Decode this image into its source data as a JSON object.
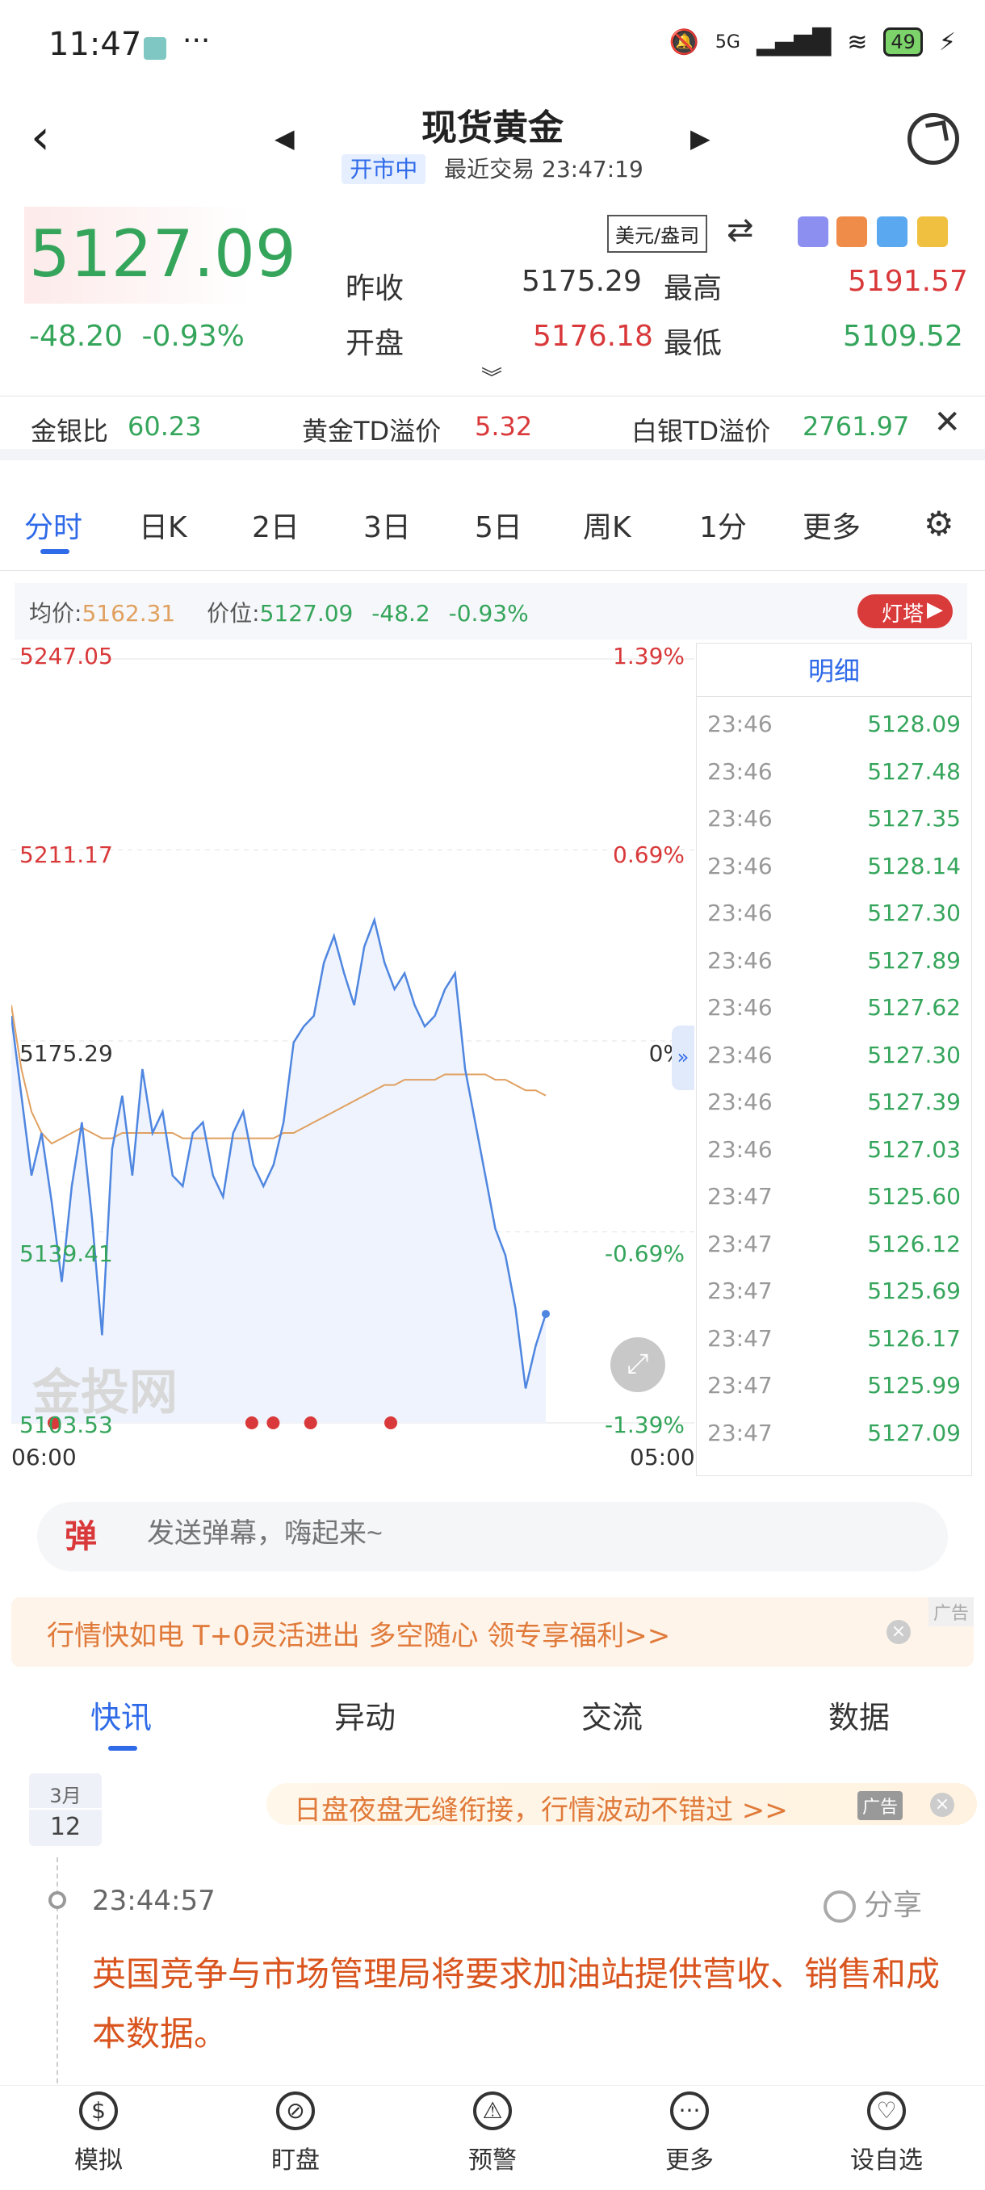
{
  "status_bar": {
    "time": "11:47",
    "dots": "···",
    "network": "5G",
    "battery": "49"
  },
  "header": {
    "title": "现货黄金",
    "market_status": "开市中",
    "last_trade": "最近交易 23:47:19"
  },
  "quote": {
    "price": "5127.09",
    "change": "-48.20",
    "change_pct": "-0.93%",
    "unit": "美元/盎司",
    "prev_close_label": "昨收",
    "prev_close": "5175.29",
    "high_label": "最高",
    "high": "5191.57",
    "open_label": "开盘",
    "open": "5176.18",
    "low_label": "最低",
    "low": "5109.52"
  },
  "ratio_bar": {
    "gold_silver_label": "金银比",
    "gold_silver": "60.23",
    "gold_td_label": "黄金TD溢价",
    "gold_td": "5.32",
    "silver_td_label": "白银TD溢价",
    "silver_td": "2761.97"
  },
  "period_tabs": [
    "分时",
    "日K",
    "2日",
    "3日",
    "5日",
    "周K",
    "1分",
    "更多"
  ],
  "chart_info": {
    "avg_label": "均价:",
    "avg_value": "5162.31",
    "price_label": "价位:",
    "price_value": "5127.09",
    "change": "-48.2",
    "change_pct": "-0.93%",
    "lighthouse": "灯塔"
  },
  "chart_data": {
    "type": "line",
    "y_ticks_left": [
      "5247.05",
      "5211.17",
      "5175.29",
      "5139.41",
      "5103.53"
    ],
    "y_ticks_right": [
      "1.39%",
      "0.69%",
      "0%",
      "-0.69%",
      "-1.39%"
    ],
    "ylim": [
      5103.53,
      5247.05
    ],
    "x_ticks": [
      "06:00",
      "05:00"
    ],
    "series": [
      {
        "values": [
          5180,
          5165,
          5150,
          5158,
          5145,
          5130,
          5148,
          5160,
          5142,
          5120,
          5155,
          5165,
          5150,
          5170,
          5158,
          5162,
          5150,
          5148,
          5158,
          5160,
          5150,
          5146,
          5158,
          5162,
          5152,
          5148,
          5152,
          5160,
          5175,
          5178,
          5180,
          5190,
          5195,
          5188,
          5182,
          5193,
          5198,
          5190,
          5185,
          5188,
          5182,
          5178,
          5180,
          5185,
          5188,
          5170,
          5160,
          5150,
          5140,
          5135,
          5125,
          5110,
          5118,
          5124
        ]
      },
      {
        "values": [
          5182,
          5170,
          5162,
          5158,
          5156,
          5157,
          5158,
          5159,
          5158,
          5157,
          5157,
          5158,
          5158,
          5158,
          5158,
          5158,
          5158,
          5157,
          5157,
          5157,
          5157,
          5157,
          5157,
          5157,
          5157,
          5157,
          5157,
          5158,
          5158,
          5159,
          5160,
          5161,
          5162,
          5163,
          5164,
          5165,
          5166,
          5167,
          5167,
          5168,
          5168,
          5168,
          5168,
          5169,
          5169,
          5169,
          5169,
          5169,
          5168,
          5168,
          5167,
          5166,
          5166,
          5165
        ]
      }
    ]
  },
  "chart_controls": {
    "fullscreen": "⤢",
    "collapse": "»",
    "watermark": "金投网"
  },
  "detail_panel": {
    "title": "明细",
    "rows": [
      {
        "time": "23:46",
        "price": "5128.09"
      },
      {
        "time": "23:46",
        "price": "5127.48"
      },
      {
        "time": "23:46",
        "price": "5127.35"
      },
      {
        "time": "23:46",
        "price": "5128.14"
      },
      {
        "time": "23:46",
        "price": "5127.30"
      },
      {
        "time": "23:46",
        "price": "5127.89"
      },
      {
        "time": "23:46",
        "price": "5127.62"
      },
      {
        "time": "23:46",
        "price": "5127.30"
      },
      {
        "time": "23:46",
        "price": "5127.39"
      },
      {
        "time": "23:46",
        "price": "5127.03"
      },
      {
        "time": "23:47",
        "price": "5125.60"
      },
      {
        "time": "23:47",
        "price": "5126.12"
      },
      {
        "time": "23:47",
        "price": "5125.69"
      },
      {
        "time": "23:47",
        "price": "5126.17"
      },
      {
        "time": "23:47",
        "price": "5125.99"
      },
      {
        "time": "23:47",
        "price": "5127.09"
      }
    ]
  },
  "danmu": {
    "icon": "弹",
    "placeholder": "发送弹幕，嗨起来~"
  },
  "promo": {
    "text": "行情快如电 T+0灵活进出 多空随心 领专享福利>>",
    "tag": "广告"
  },
  "news_tabs": [
    "快讯",
    "异动",
    "交流",
    "数据"
  ],
  "news": {
    "month": "3月",
    "day": "12",
    "ad_text": "日盘夜盘无缝衔接，行情波动不错过 >>",
    "ad_tag": "广告",
    "time": "23:44:57",
    "share": "分享",
    "headline": "英国竞争与市场管理局将要求加油站提供营收、销售和成本数据。"
  },
  "bottom_nav": [
    {
      "label": "模拟",
      "icon": "$"
    },
    {
      "label": "盯盘",
      "icon": "⊘"
    },
    {
      "label": "预警",
      "icon": "⚠"
    },
    {
      "label": "更多",
      "icon": "···"
    },
    {
      "label": "设自选",
      "icon": "♡"
    }
  ],
  "colors": {
    "accent": "#2f6ae8",
    "up": "#d9393a",
    "down": "#35a55b",
    "avg_line": "#e0a060",
    "price_line": "#4f86e0"
  }
}
